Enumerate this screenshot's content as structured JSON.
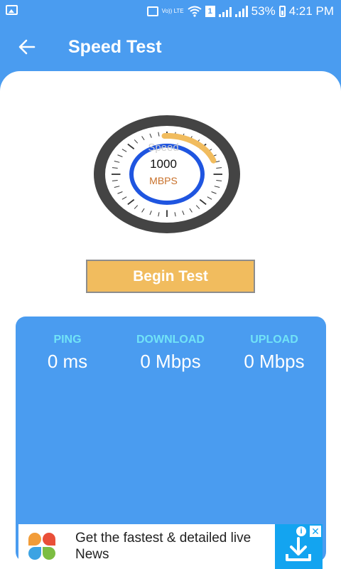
{
  "status": {
    "battery": "53%",
    "time": "4:21 PM",
    "sim_number": "1",
    "volte_label": "Vo)) LTE"
  },
  "app_bar": {
    "title": "Speed Test",
    "back_icon": "arrow-left-icon"
  },
  "gauge": {
    "label": "Speed",
    "value": "1000",
    "unit": "MBPS",
    "progress_fraction": 0.2,
    "colors": {
      "ring": "#444444",
      "face": "#ffffff",
      "inner_ring": "#1f55e0",
      "arc": "#f1bc5e",
      "unit": "#c8702a"
    }
  },
  "actions": {
    "begin_label": "Begin Test"
  },
  "results": {
    "ping": {
      "label": "PING",
      "value": "0 ms"
    },
    "download": {
      "label": "DOWNLOAD",
      "value": "0 Mbps"
    },
    "upload": {
      "label": "UPLOAD",
      "value": "0 Mbps"
    }
  },
  "ad": {
    "text": "Get the fastest & detailed live News",
    "info_icon": "info-icon",
    "close_icon": "close-icon",
    "download_icon": "download-icon"
  },
  "colors": {
    "primary": "#4a9cf0",
    "button": "#f1bc5e",
    "metric_label": "#71e3f7"
  }
}
